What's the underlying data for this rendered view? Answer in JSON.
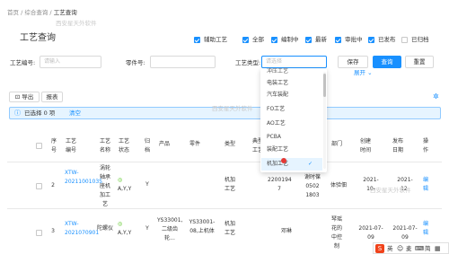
{
  "breadcrumb": [
    "首页",
    "综合查询",
    "工艺查询"
  ],
  "page_title": "工艺查询",
  "status_filters": [
    {
      "label": "辅助工艺",
      "checked": true
    },
    {
      "label": "全部",
      "checked": true
    },
    {
      "label": "编制中",
      "checked": true
    },
    {
      "label": "最新",
      "checked": true
    },
    {
      "label": "审批中",
      "checked": true
    },
    {
      "label": "已发布",
      "checked": true
    },
    {
      "label": "已归档",
      "checked": false
    }
  ],
  "search": {
    "process_no_label": "工艺编号:",
    "process_no_placeholder": "请输入",
    "part_no_label": "零件号:",
    "type_label": "工艺类型:",
    "type_placeholder": "请选择",
    "save_button": "保存",
    "query_button": "查询",
    "reset_button": "重置",
    "expand_link": "展开"
  },
  "toolbar": {
    "export": "导出",
    "report": "报表"
  },
  "selection": {
    "text": "已选择 0 项",
    "clear": "清空"
  },
  "table": {
    "headers": {
      "seq": "序号",
      "process_no": "工艺编号",
      "process_name": "工艺名称",
      "process_status": "工艺状态",
      "sub": "归档",
      "product": "产品",
      "part": "零件",
      "type": "类型",
      "prepared_by": "典型工艺",
      "dept": "部门",
      "created": "创建时间",
      "published": "发布日期",
      "ops": "操作"
    },
    "rows": [
      {
        "seq": "2",
        "process_no": "XTW-20211001035",
        "process_name": "涡轮轴承座机加工艺",
        "status": "A,Y,Y",
        "sub": "Y",
        "product": "",
        "part": "",
        "type": "机加工艺",
        "prepared_by": "2200194 7",
        "prep_detail": "01189 谢时葆 0502 1803",
        "dept": "体验佃",
        "created": "2021-10-",
        "published": "2021-12-",
        "ops": "编辑"
      },
      {
        "seq": "3",
        "process_no": "XTW-2021070901",
        "process_name": "陀螺仪",
        "status": "A,Y,Y",
        "sub": "Y",
        "product": "YS33001,二级齿轮...",
        "part": "YS33001-08,上机体",
        "type": "机加工艺",
        "prepared_by": "",
        "prep_detail": "邓琳",
        "dept": "琴瑶花的中控制",
        "created": "2021-07-09",
        "published": "2021-07-09",
        "ops": "编辑"
      }
    ]
  },
  "dropdown": {
    "options": [
      "冲压工艺",
      "电装工艺",
      "汽车装配",
      "FO工艺",
      "AO工艺",
      "PCBA",
      "装配工艺",
      "机加工艺"
    ],
    "selected": "机加工艺"
  },
  "watermark": "西安星天外软件",
  "tray": [
    "英",
    "麦",
    "简"
  ],
  "colors": {
    "accent": "#1890ff",
    "info_bg": "#e6f4ff",
    "tray_red": "#f0421a"
  }
}
